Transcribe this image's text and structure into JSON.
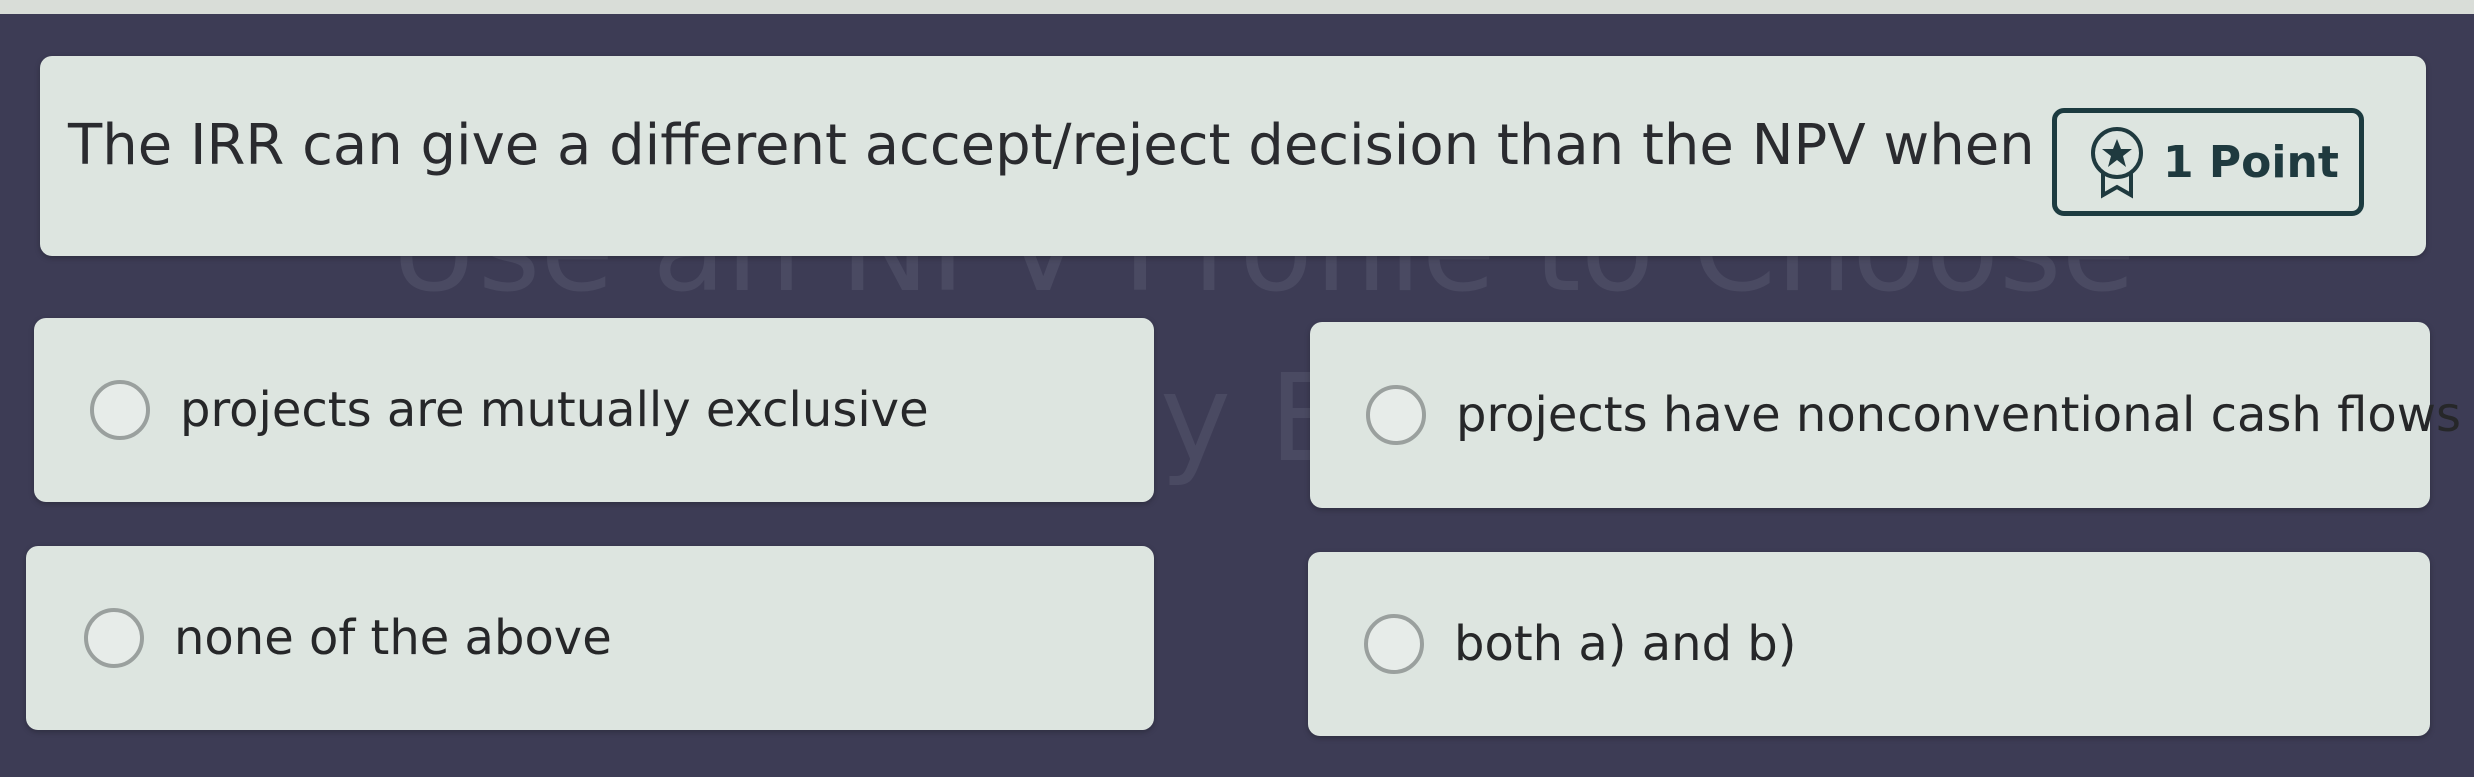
{
  "background_text": {
    "line1": "Use an NPV Profile to Choose",
    "line2": "y E"
  },
  "question": {
    "text": "The IRR can give a different accept/reject decision than the NPV when",
    "points_label": "1 Point",
    "points_icon": "award-badge-icon"
  },
  "options": [
    {
      "label": "projects are mutually exclusive",
      "selected": false
    },
    {
      "label": "projects have nonconventional cash flows",
      "selected": false
    },
    {
      "label": "none of the above",
      "selected": false
    },
    {
      "label": "both a) and b)",
      "selected": false
    }
  ],
  "colors": {
    "background": "#3d3c55",
    "card": "#dde5e0",
    "badge_border": "#1c3b40",
    "text": "#2a2b2f"
  }
}
